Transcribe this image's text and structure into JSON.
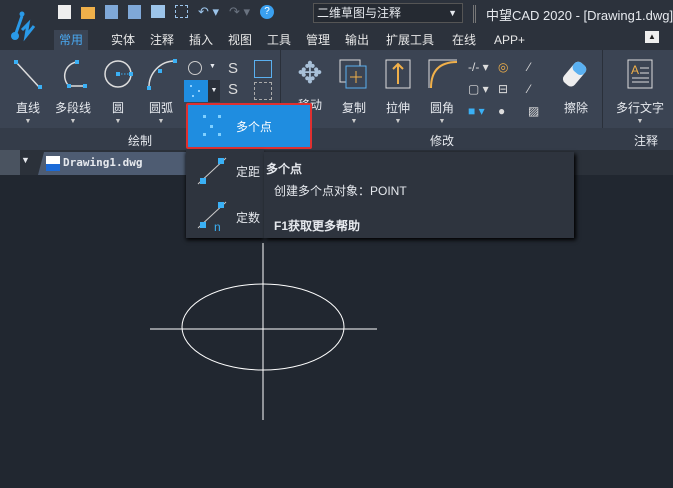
{
  "quick_access": {
    "workspace": "二维草图与注释"
  },
  "window_title": "中望CAD 2020 - [Drawing1.dwg]",
  "tabs": [
    "常用",
    "实体",
    "注释",
    "插入",
    "视图",
    "工具",
    "管理",
    "输出",
    "扩展工具",
    "在线",
    "APP+"
  ],
  "draw_panel": {
    "label": "绘制",
    "buttons": [
      "直线",
      "多段线",
      "圆",
      "圆弧"
    ]
  },
  "modify_panel": {
    "label": "修改",
    "buttons": [
      "移动",
      "复制",
      "拉伸",
      "圆角",
      "擦除"
    ]
  },
  "annotate_panel": {
    "label": "注释",
    "buttons": [
      "多行文字"
    ]
  },
  "document_tab": "Drawing1.dwg",
  "point_dropdown": {
    "selected": "多个点",
    "items": [
      "定距",
      "定数"
    ]
  },
  "tooltip": {
    "title": "多个点",
    "description": "创建多个点对象：POINT",
    "help": "F1获取更多帮助"
  },
  "colors": {
    "accent": "#1f8de0",
    "highlight_border": "#e03030"
  }
}
